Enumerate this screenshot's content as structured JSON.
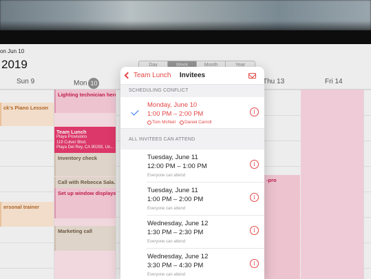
{
  "header": {
    "date_small": "on Jun 10",
    "year": "2019",
    "views": [
      "Day",
      "Week",
      "Month",
      "Year"
    ],
    "active_view": "Week"
  },
  "days": [
    {
      "label": "Sun 9"
    },
    {
      "label": "Mon",
      "badge": "10"
    },
    {
      "label": "Thu 13"
    },
    {
      "label": "Fri 14"
    }
  ],
  "events": {
    "piano": "ck's Piano Lesson",
    "lighting": "Lighting technician here",
    "team_lunch": {
      "title": "Team Lunch",
      "line1": "Playa Provisions",
      "line2": "119 Culver Blvd.",
      "line3": "Playa Del Rey, CA 90293, Un..."
    },
    "inventory": "Inventory check",
    "call_rebecca": "Call with Rebecca Sala...",
    "window_displays": "Set up window displays",
    "trainer": "ersonal trainer",
    "marketing": "Marketing call",
    "pro": "-pro"
  },
  "popover": {
    "back_label": "Team Lunch",
    "title": "Invitees",
    "conflict_header": "SCHEDULING CONFLICT",
    "conflict": {
      "day": "Monday, June 10",
      "time": "1:00 PM – 2:00 PM",
      "people": [
        "Tom McNeil",
        "Daniel Carroll"
      ]
    },
    "all_header": "ALL INVITEES CAN ATTEND",
    "slots": [
      {
        "day": "Tuesday, June 11",
        "time": "12:00 PM – 1:00 PM",
        "note": "Everyone can attend"
      },
      {
        "day": "Tuesday, June 11",
        "time": "1:00 PM – 2:00 PM",
        "note": "Everyone can attend"
      },
      {
        "day": "Wednesday, June 12",
        "time": "1:30 PM – 2:30 PM",
        "note": "Everyone can attend"
      },
      {
        "day": "Wednesday, June 12",
        "time": "3:30 PM – 4:30 PM",
        "note": "Everyone can attend"
      }
    ]
  },
  "colors": {
    "accent": "#e34545",
    "check": "#1e6ff0",
    "event_pink": "#f7cbd9",
    "event_hot": "#e53b6e",
    "event_orange": "#fbe6d3"
  }
}
